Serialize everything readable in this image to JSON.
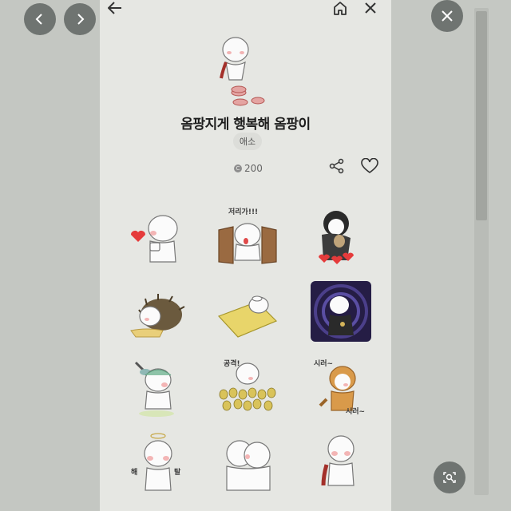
{
  "pack": {
    "title": "옴팡지게 행복해 옴팡이",
    "author": "애소",
    "price": "200",
    "coin_symbol": "C"
  },
  "sticker_captions": {
    "s2": "저리가!!!",
    "s8": "공격!",
    "s9_top": "시러~",
    "s9_bottom": "시러~",
    "s10_left": "해",
    "s10_right": "탈"
  },
  "icons": [
    "chevron-left-icon",
    "chevron-right-icon",
    "close-icon",
    "back-arrow-icon",
    "home-icon",
    "share-icon",
    "heart-icon",
    "image-search-icon"
  ],
  "colors": {
    "background": "#c9cbc7",
    "page": "#e6e7e3",
    "heart": "#e53b3b",
    "overlay_button": "#6f7471"
  }
}
